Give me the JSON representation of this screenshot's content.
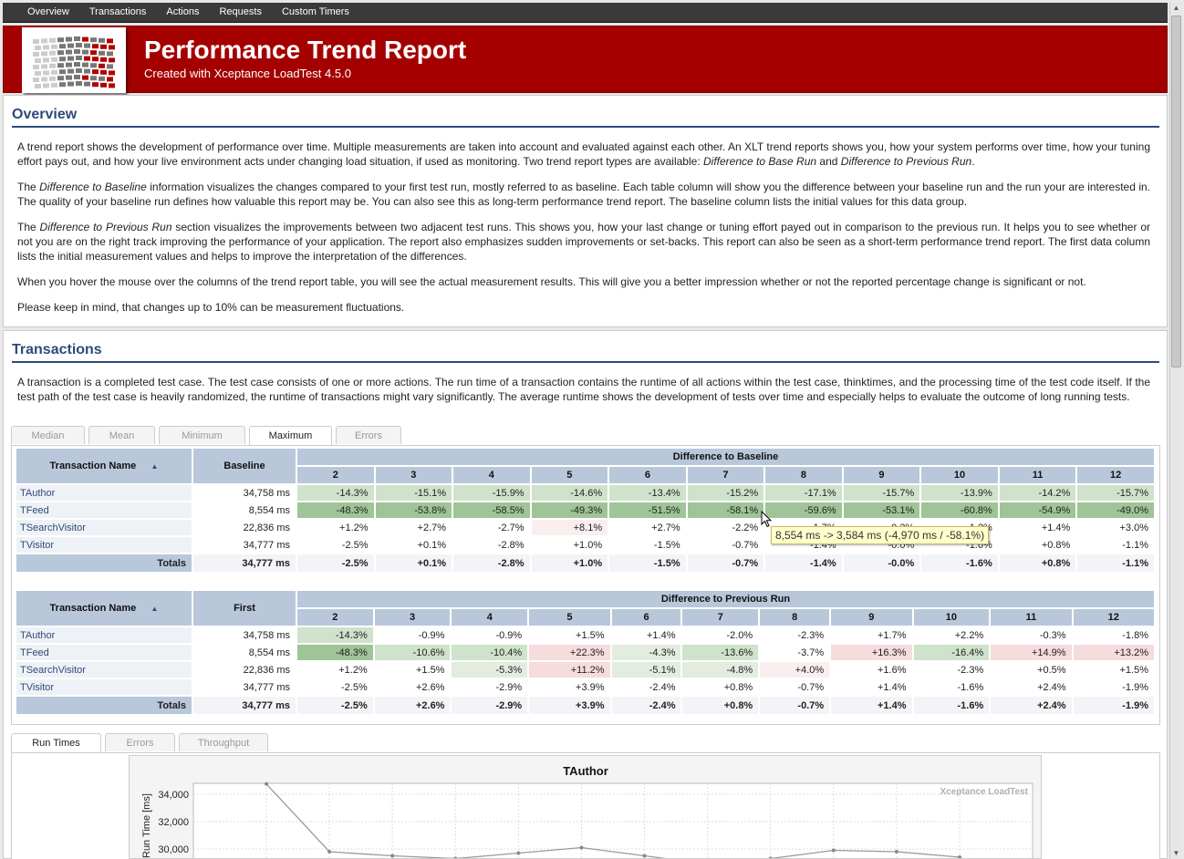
{
  "nav": {
    "items": [
      "Overview",
      "Transactions",
      "Actions",
      "Requests",
      "Custom Timers"
    ]
  },
  "header": {
    "title": "Performance Trend Report",
    "subtitle": "Created with Xceptance LoadTest  4.5.0"
  },
  "overview": {
    "title": "Overview",
    "p1": "A trend report shows the development of performance over time. Multiple measurements are taken into account and evaluated against each other. An XLT trend reports shows you, how your system performs over time, how your tuning effort pays out, and how your live environment acts under changing load situation, if used as monitoring. Two trend report types are available: Difference to Base Run and Difference to Previous Run.",
    "p2": "The Difference to Baseline information visualizes the changes compared to your first test run, mostly referred to as baseline. Each table column will show you the difference between your baseline run and the run your are interested in. The quality of your baseline run defines how valuable this report may be. You can also see this as long-term performance trend report. The baseline column lists the initial values for this data group.",
    "p3": "The Difference to Previous Run section visualizes the improvements between two adjacent test runs. This shows you, how your last change or tuning effort payed out in comparison to the previous run. It helps you to see whether or not you are on the right track improving the performance of your application. The report also emphasizes sudden improvements or set-backs. This report can also be seen as a short-term performance trend report. The first data column lists the initial measurement values and helps to improve the interpretation of the differences.",
    "p4": "When you hover the mouse over the columns of the trend report table, you will see the actual measurement results. This will give you a better impression whether or not the reported percentage change is significant or not.",
    "p5": "Please keep in mind, that changes up to 10% can be measurement fluctuations."
  },
  "transactions": {
    "title": "Transactions",
    "intro": "A transaction is a completed test case. The test case consists of one or more actions. The run time of a transaction contains the runtime of all actions within the test case, thinktimes, and the processing time of the test code itself. If the test path of the test case is heavily randomized, the runtime of transactions might vary significantly. The average runtime shows the development of tests over time and especially helps to evaluate the outcome of long running tests.",
    "tabs": [
      "Median",
      "Mean",
      "Minimum",
      "Maximum",
      "Errors"
    ],
    "active_tab": "Maximum",
    "runs": [
      "2",
      "3",
      "4",
      "5",
      "6",
      "7",
      "8",
      "9",
      "10",
      "11",
      "12"
    ],
    "baseline_table": {
      "col_name": "Transaction Name",
      "col_base": "Baseline",
      "group_header": "Difference to Baseline",
      "rows": [
        {
          "name": "TAuthor",
          "base": "34,758 ms",
          "values": [
            "-14.3%",
            "-15.1%",
            "-15.9%",
            "-14.6%",
            "-13.4%",
            "-15.2%",
            "-17.1%",
            "-15.7%",
            "-13.9%",
            "-14.2%",
            "-15.7%"
          ]
        },
        {
          "name": "TFeed",
          "base": "8,554 ms",
          "values": [
            "-48.3%",
            "-53.8%",
            "-58.5%",
            "-49.3%",
            "-51.5%",
            "-58.1%",
            "-59.6%",
            "-53.1%",
            "-60.8%",
            "-54.9%",
            "-49.0%"
          ]
        },
        {
          "name": "TSearchVisitor",
          "base": "22,836 ms",
          "values": [
            "+1.2%",
            "+2.7%",
            "-2.7%",
            "+8.1%",
            "+2.7%",
            "-2.2%",
            "-1.7%",
            "-0.3%",
            "-1.2%",
            "+1.4%",
            "+3.0%"
          ]
        },
        {
          "name": "TVisitor",
          "base": "34,777 ms",
          "values": [
            "-2.5%",
            "+0.1%",
            "-2.8%",
            "+1.0%",
            "-1.5%",
            "-0.7%",
            "-1.4%",
            "-0.0%",
            "-1.6%",
            "+0.8%",
            "-1.1%"
          ]
        }
      ],
      "totals": {
        "label": "Totals",
        "base": "34,777 ms",
        "values": [
          "-2.5%",
          "+0.1%",
          "-2.8%",
          "+1.0%",
          "-1.5%",
          "-0.7%",
          "-1.4%",
          "-0.0%",
          "-1.6%",
          "+0.8%",
          "-1.1%"
        ]
      }
    },
    "previous_table": {
      "col_name": "Transaction Name",
      "col_base": "First",
      "group_header": "Difference to Previous Run",
      "rows": [
        {
          "name": "TAuthor",
          "base": "34,758 ms",
          "values": [
            "-14.3%",
            "-0.9%",
            "-0.9%",
            "+1.5%",
            "+1.4%",
            "-2.0%",
            "-2.3%",
            "+1.7%",
            "+2.2%",
            "-0.3%",
            "-1.8%"
          ]
        },
        {
          "name": "TFeed",
          "base": "8,554 ms",
          "values": [
            "-48.3%",
            "-10.6%",
            "-10.4%",
            "+22.3%",
            "-4.3%",
            "-13.6%",
            "-3.7%",
            "+16.3%",
            "-16.4%",
            "+14.9%",
            "+13.2%"
          ]
        },
        {
          "name": "TSearchVisitor",
          "base": "22,836 ms",
          "values": [
            "+1.2%",
            "+1.5%",
            "-5.3%",
            "+11.2%",
            "-5.1%",
            "-4.8%",
            "+4.0%",
            "+1.6%",
            "-2.3%",
            "+0.5%",
            "+1.5%"
          ]
        },
        {
          "name": "TVisitor",
          "base": "34,777 ms",
          "values": [
            "-2.5%",
            "+2.6%",
            "-2.9%",
            "+3.9%",
            "-2.4%",
            "+0.8%",
            "-0.7%",
            "+1.4%",
            "-1.6%",
            "+2.4%",
            "-1.9%"
          ]
        }
      ],
      "totals": {
        "label": "Totals",
        "base": "34,777 ms",
        "values": [
          "-2.5%",
          "+2.6%",
          "-2.9%",
          "+3.9%",
          "-2.4%",
          "+0.8%",
          "-0.7%",
          "+1.4%",
          "-1.6%",
          "+2.4%",
          "-1.9%"
        ]
      }
    },
    "tooltip": "8,554 ms -> 3,584 ms (-4,970 ms / -58.1%)",
    "chart_tabs": [
      "Run Times",
      "Errors",
      "Throughput"
    ],
    "chart_active_tab": "Run Times"
  },
  "chart_data": {
    "type": "line",
    "title": "TAuthor",
    "watermark": "Xceptance LoadTest",
    "ylabel": "Run Time [ms]",
    "yticks": [
      "34,000",
      "32,000",
      "30,000"
    ],
    "ylim": [
      28800,
      34800
    ],
    "x": [
      1,
      2,
      3,
      4,
      5,
      6,
      7,
      8,
      9,
      10,
      11,
      12
    ],
    "values": [
      34758,
      29800,
      29500,
      29300,
      29700,
      30100,
      29500,
      28900,
      29300,
      29900,
      29800,
      29400
    ],
    "grid": true
  },
  "colors": {
    "banner": "#a40000",
    "header_blue": "#2f4a7a",
    "table_header": "#b8c8da",
    "improvement": "#9fc497",
    "regression": "#f6dcdc"
  }
}
